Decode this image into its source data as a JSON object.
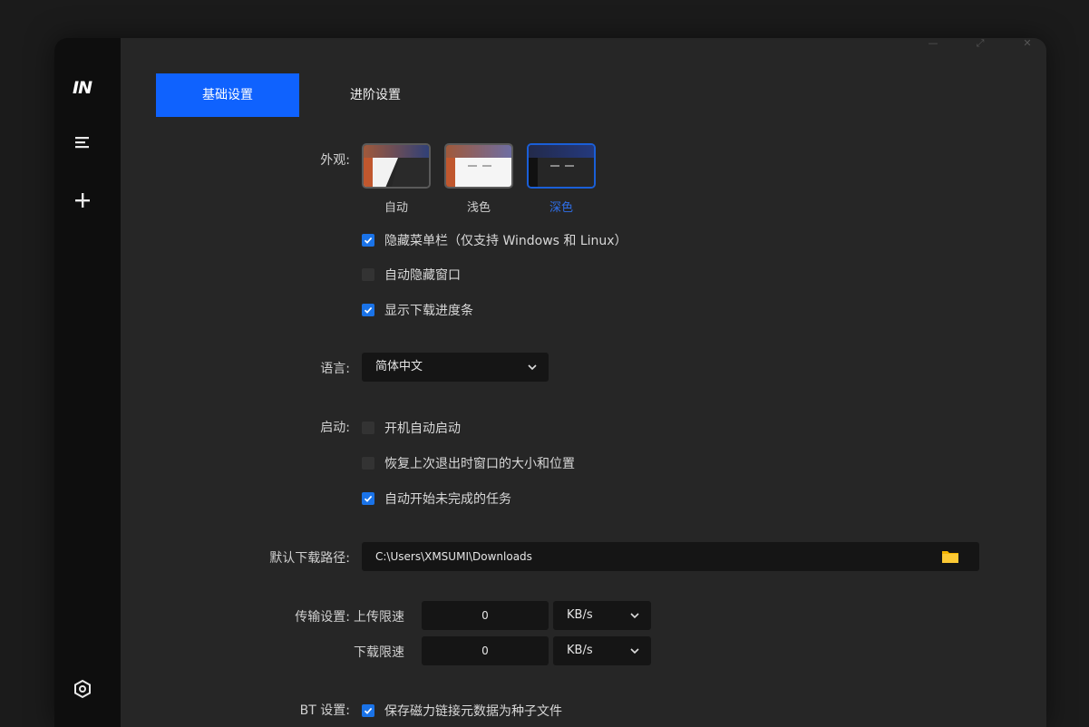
{
  "sidebar": {
    "logo": "IN",
    "menu_icon": "menu-icon",
    "add_icon": "plus-icon",
    "settings_icon": "settings-icon"
  },
  "tabs": {
    "basic": "基础设置",
    "advanced": "进阶设置"
  },
  "appearance": {
    "label": "外观:",
    "options": [
      "自动",
      "浅色",
      "深色"
    ],
    "selected": "深色"
  },
  "checkboxes": {
    "hide_menubar": {
      "label": "隐藏菜单栏（仅支持 Windows 和 Linux）",
      "checked": true
    },
    "auto_hide_window": {
      "label": "自动隐藏窗口",
      "checked": false
    },
    "show_progress": {
      "label": "显示下载进度条",
      "checked": true
    }
  },
  "language": {
    "label": "语言:",
    "value": "简体中文"
  },
  "startup": {
    "label": "启动:",
    "auto_launch": {
      "label": "开机自动启动",
      "checked": false
    },
    "restore_window": {
      "label": "恢复上次退出时窗口的大小和位置",
      "checked": false
    },
    "resume_tasks": {
      "label": "自动开始未完成的任务",
      "checked": true
    }
  },
  "download_path": {
    "label": "默认下载路径:",
    "value": "C:\\Users\\XMSUMI\\Downloads"
  },
  "transfer": {
    "label": "传输设置:",
    "upload_label": "上传限速",
    "upload_value": "0",
    "upload_unit": "KB/s",
    "download_label": "下载限速",
    "download_value": "0",
    "download_unit": "KB/s"
  },
  "bt": {
    "label": "BT 设置:",
    "save_magnet": {
      "label": "保存磁力链接元数据为种子文件",
      "checked": true
    }
  },
  "colors": {
    "accent": "#0f62fe",
    "sidebar": "#0e0e0e",
    "panel": "#262626"
  }
}
